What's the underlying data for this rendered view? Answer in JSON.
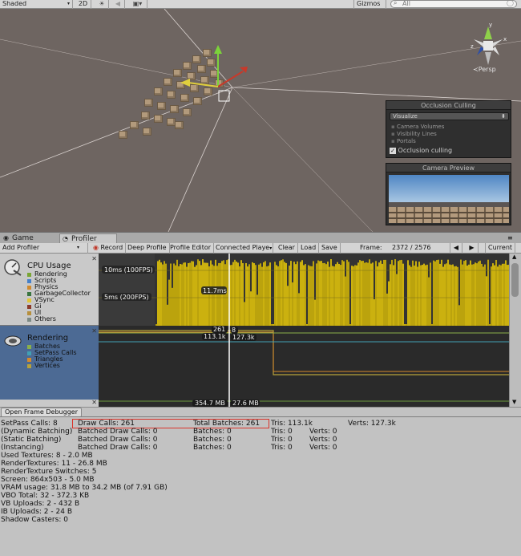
{
  "scene_toolbar": {
    "shading_mode": "Shaded",
    "mode_2d": "2D",
    "sun_icon": "sun-icon",
    "audio_icon": "speaker-icon",
    "image_icon": "image-icon",
    "gizmos": "Gizmos",
    "search_placeholder": "All"
  },
  "scene": {
    "projection": "Persp",
    "gizmo_axis_y": "y",
    "gizmo_axis_x": "x",
    "gizmo_axis_z": "z"
  },
  "occlusion_panel": {
    "title": "Occlusion Culling",
    "dropdown": "Visualize",
    "options": [
      "Camera Volumes",
      "Visibility Lines",
      "Portals"
    ],
    "checkbox_label": "Occlusion culling",
    "checked": true
  },
  "camera_preview": {
    "title": "Camera Preview"
  },
  "tabs": {
    "game": "Game",
    "profiler": "Profiler"
  },
  "profiler_toolbar": {
    "add_profiler": "Add Profiler",
    "record": "Record",
    "deep_profile": "Deep Profile",
    "profile_editor": "Profile Editor",
    "connected_player": "Connected Playe",
    "clear": "Clear",
    "load": "Load",
    "save": "Save",
    "frame_label": "Frame:",
    "frame_value": "2372 / 2576",
    "current": "Current"
  },
  "cpu_area": {
    "title": "CPU Usage",
    "legend": [
      {
        "label": "Rendering",
        "color": "#79a534"
      },
      {
        "label": "Scripts",
        "color": "#4580c9"
      },
      {
        "label": "Physics",
        "color": "#d08a2e"
      },
      {
        "label": "GarbageCollector",
        "color": "#3a7540"
      },
      {
        "label": "VSync",
        "color": "#e0c438"
      },
      {
        "label": "Gi",
        "color": "#8b3a2a"
      },
      {
        "label": "UI",
        "color": "#b78f3c"
      },
      {
        "label": "Others",
        "color": "#7c8a85"
      }
    ],
    "label_10ms": "10ms (100FPS)",
    "label_5ms": "5ms (200FPS)",
    "label_frame": "11.7ms"
  },
  "render_area": {
    "title": "Rendering",
    "legend": [
      {
        "label": "Batches",
        "color": "#8ab04a"
      },
      {
        "label": "SetPass Calls",
        "color": "#41a0b4"
      },
      {
        "label": "Triangles",
        "color": "#d58a2c"
      },
      {
        "label": "Vertices",
        "color": "#b7a23a"
      }
    ],
    "label_batches": "261",
    "label_setpass": "8",
    "label_tris": "113.1k",
    "label_verts": "127.3k"
  },
  "extra_area": {
    "label_a": "354.7 MB",
    "label_b": "27.6 MB"
  },
  "frame_debugger": "Open Frame Debugger",
  "stats": {
    "row1": {
      "a": "SetPass Calls: 8",
      "b": "Draw Calls: 261",
      "c": "Total Batches: 261",
      "d": "Tris: 113.1k",
      "e": "Verts: 127.3k"
    },
    "row2": {
      "a": "(Dynamic Batching)",
      "b": "Batched Draw Calls: 0",
      "c": "Batches: 0",
      "d": "Tris: 0",
      "e": "Verts: 0"
    },
    "row3": {
      "a": "(Static Batching)",
      "b": "Batched Draw Calls: 0",
      "c": "Batches: 0",
      "d": "Tris: 0",
      "e": "Verts: 0"
    },
    "row4": {
      "a": "(Instancing)",
      "b": "Batched Draw Calls: 0",
      "c": "Batches: 0",
      "d": "Tris: 0",
      "e": "Verts: 0"
    },
    "lines": [
      "Used Textures: 8 - 2.0 MB",
      "RenderTextures: 11 - 26.8 MB",
      "RenderTexture Switches: 5",
      "Screen: 864x503 - 5.0 MB",
      "VRAM usage: 31.8 MB to 34.2 MB (of 7.91 GB)",
      "VBO Total: 32 - 372.3 KB",
      "VB Uploads: 2 - 432 B",
      "IB Uploads: 2 - 24 B",
      "Shadow Casters: 0"
    ]
  }
}
